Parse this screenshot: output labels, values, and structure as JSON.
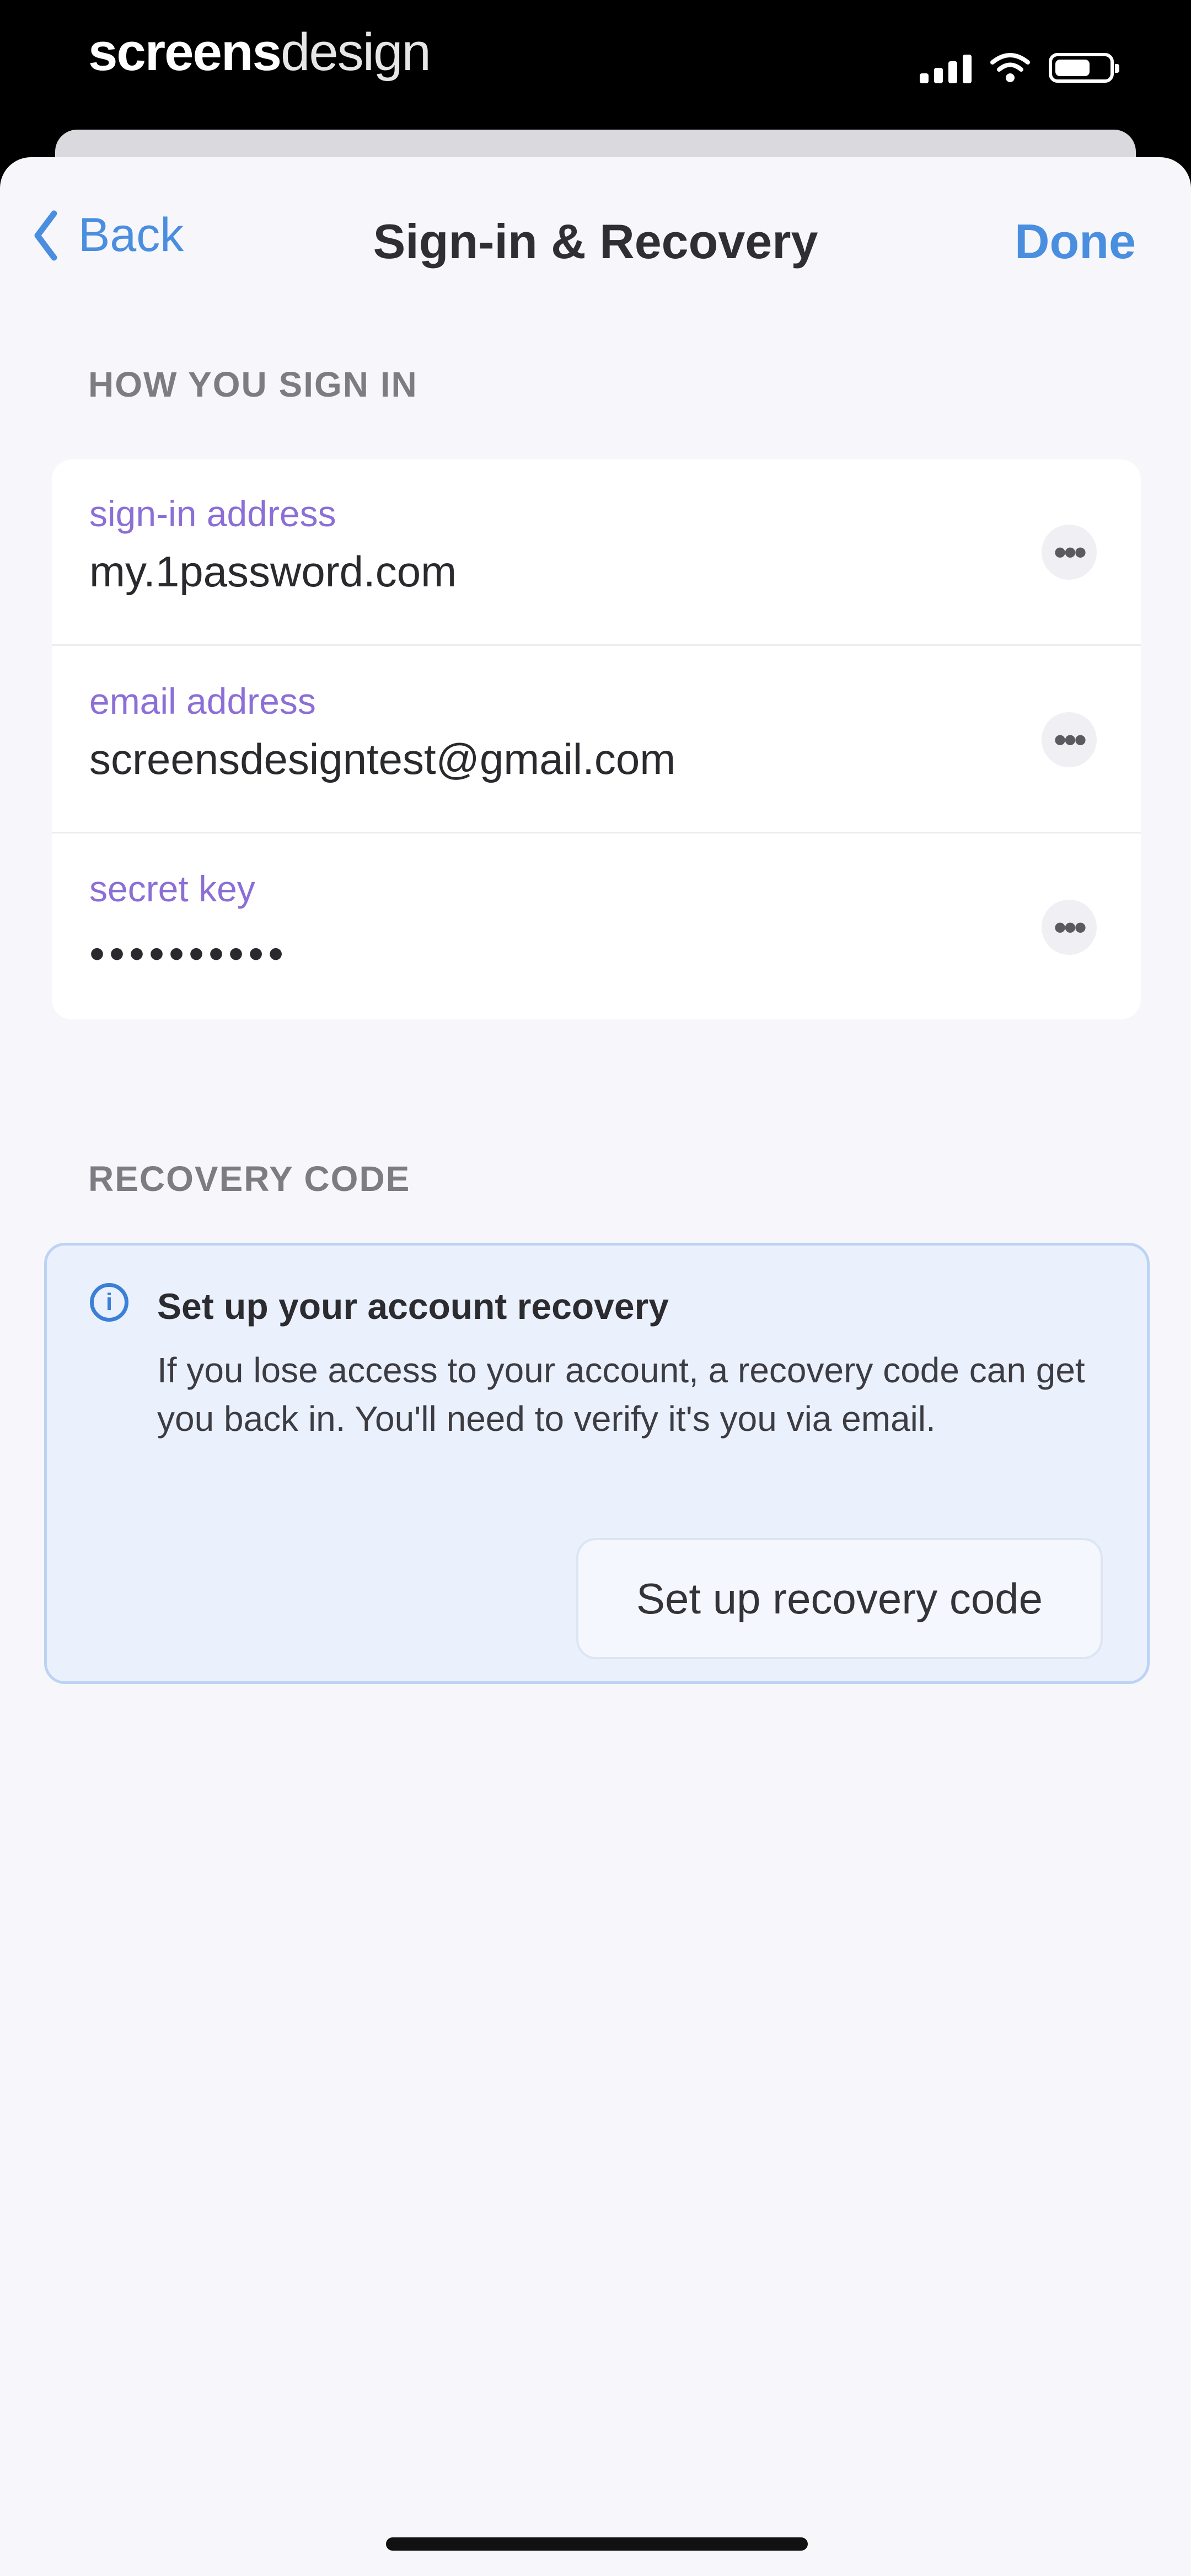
{
  "status_bar": {
    "brand_bold": "screens",
    "brand_light": "design"
  },
  "nav": {
    "back_label": "Back",
    "title": "Sign-in & Recovery",
    "done_label": "Done"
  },
  "sections": {
    "how_sign_in": "HOW YOU SIGN IN",
    "recovery_code": "RECOVERY CODE"
  },
  "fields": [
    {
      "label": "sign-in address",
      "value": "my.1password.com"
    },
    {
      "label": "email address",
      "value": "screensdesigntest@gmail.com"
    },
    {
      "label": "secret key",
      "value": "••••••••••"
    }
  ],
  "more_glyph": "•••",
  "recovery": {
    "info_glyph": "i",
    "title": "Set up your account recovery",
    "body": "If you lose access to your account, a recovery code can get you back in. You'll need to verify it's you via email.",
    "button_label": "Set up recovery code"
  },
  "colors": {
    "accent": "#4a8ee0",
    "field_label": "#8b6fd6",
    "info_bg": "#eaf1fd",
    "sheet_bg": "#f7f6fa"
  },
  "icons": {
    "back": "chevron-left-icon",
    "more": "ellipsis-icon",
    "info": "info-circle-icon",
    "signal": "cellular-signal-icon",
    "wifi": "wifi-icon",
    "battery": "battery-icon"
  }
}
